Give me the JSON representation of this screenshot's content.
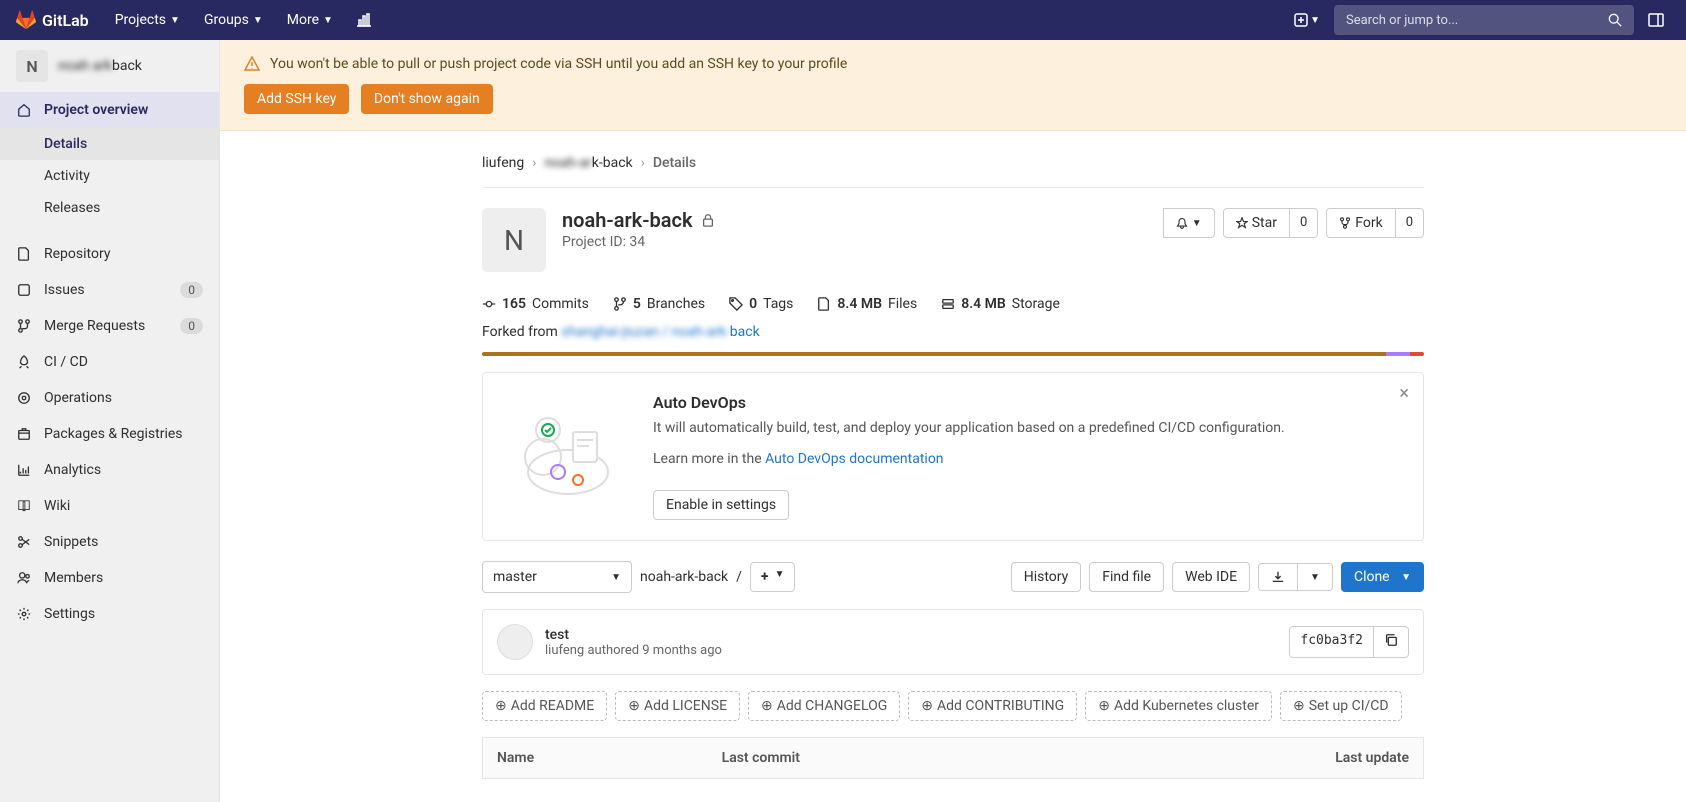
{
  "nav": {
    "brand": "GitLab",
    "items": [
      "Projects",
      "Groups",
      "More"
    ],
    "search_placeholder": "Search or jump to..."
  },
  "sidebar": {
    "project_letter": "N",
    "project_name_suffix": "back",
    "overview": "Project overview",
    "sub": {
      "details": "Details",
      "activity": "Activity",
      "releases": "Releases"
    },
    "items": {
      "repository": "Repository",
      "issues": "Issues",
      "issues_count": "0",
      "merge": "Merge Requests",
      "merge_count": "0",
      "cicd": "CI / CD",
      "operations": "Operations",
      "packages": "Packages & Registries",
      "analytics": "Analytics",
      "wiki": "Wiki",
      "snippets": "Snippets",
      "members": "Members",
      "settings": "Settings"
    }
  },
  "alert": {
    "text": "You won't be able to pull or push project code via SSH until you add an SSH key to your profile",
    "add_key": "Add SSH key",
    "dismiss": "Don't show again"
  },
  "breadcrumb": {
    "owner": "liufeng",
    "project_suffix": "k-back",
    "page": "Details"
  },
  "hero": {
    "letter": "N",
    "title": "noah-ark-back",
    "project_id": "Project ID: 34",
    "star": "Star",
    "star_count": "0",
    "fork": "Fork",
    "fork_count": "0"
  },
  "stats": {
    "commits_n": "165",
    "commits": "Commits",
    "branches_n": "5",
    "branches": "Branches",
    "tags_n": "0",
    "tags": "Tags",
    "files_n": "8.4 MB",
    "files": "Files",
    "storage_n": "8.4 MB",
    "storage": "Storage"
  },
  "forked": {
    "label": "Forked from ",
    "link_suffix": "back"
  },
  "devops": {
    "title": "Auto DevOps",
    "desc": "It will automatically build, test, and deploy your application based on a predefined CI/CD configuration.",
    "learn": "Learn more in the ",
    "link": "Auto DevOps documentation",
    "enable": "Enable in settings"
  },
  "toolbar": {
    "branch": "master",
    "path": "noah-ark-back",
    "history": "History",
    "find": "Find file",
    "ide": "Web IDE",
    "clone": "Clone"
  },
  "commit": {
    "title": "test",
    "author": "liufeng",
    "verb": "authored",
    "when": "9 months ago",
    "sha": "fc0ba3f2"
  },
  "addfiles": {
    "readme": "Add README",
    "license": "Add LICENSE",
    "changelog": "Add CHANGELOG",
    "contrib": "Add CONTRIBUTING",
    "k8s": "Add Kubernetes cluster",
    "cicd": "Set up CI/CD"
  },
  "table": {
    "name": "Name",
    "last_commit": "Last commit",
    "last_update": "Last update"
  }
}
